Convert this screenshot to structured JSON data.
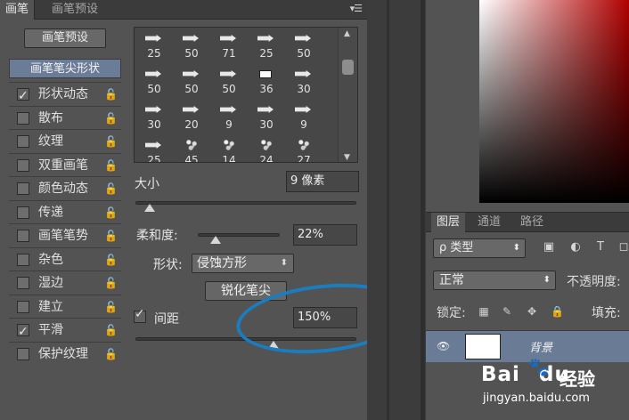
{
  "brush_panel": {
    "tabs": [
      {
        "label": "画笔"
      },
      {
        "label": "画笔预设"
      }
    ],
    "menu_glyph": "▾☰",
    "preset_button": "画笔预设",
    "options_header": "画笔笔尖形状",
    "options": [
      {
        "label": "形状动态",
        "checked": true
      },
      {
        "label": "散布",
        "checked": false
      },
      {
        "label": "纹理",
        "checked": false
      },
      {
        "label": "双重画笔",
        "checked": false
      },
      {
        "label": "颜色动态",
        "checked": false
      },
      {
        "label": "传递",
        "checked": false
      },
      {
        "label": "画笔笔势",
        "checked": false
      },
      {
        "label": "杂色",
        "checked": false
      },
      {
        "label": "湿边",
        "checked": false
      },
      {
        "label": "建立",
        "checked": false
      },
      {
        "label": "平滑",
        "checked": true
      },
      {
        "label": "保护纹理",
        "checked": false
      }
    ],
    "lock_glyph": "🔓",
    "tips": [
      {
        "size": "25",
        "shape": "arrow"
      },
      {
        "size": "50",
        "shape": "arrow"
      },
      {
        "size": "71",
        "shape": "arrow"
      },
      {
        "size": "25",
        "shape": "arrow"
      },
      {
        "size": "50",
        "shape": "arrow"
      },
      {
        "size": "50",
        "shape": "arrow"
      },
      {
        "size": "50",
        "shape": "arrow"
      },
      {
        "size": "50",
        "shape": "arrow"
      },
      {
        "size": "36",
        "shape": "square"
      },
      {
        "size": "30",
        "shape": "arrow"
      },
      {
        "size": "30",
        "shape": "arrow"
      },
      {
        "size": "20",
        "shape": "arrow"
      },
      {
        "size": "9",
        "shape": "arrow"
      },
      {
        "size": "30",
        "shape": "arrow"
      },
      {
        "size": "9",
        "shape": "arrow"
      },
      {
        "size": "25",
        "shape": "arrow"
      },
      {
        "size": "45",
        "shape": "splatter"
      },
      {
        "size": "14",
        "shape": "splatter"
      },
      {
        "size": "24",
        "shape": "splatter"
      },
      {
        "size": "27",
        "shape": "splatter"
      }
    ],
    "size_label": "大小",
    "size_value": "9 像素",
    "hardness_label": "柔和度:",
    "hardness_value": "22%",
    "hardness_fraction": 0.22,
    "shape_label": "形状:",
    "shape_value": "侵蚀方形",
    "sharpen_button": "锐化笔尖",
    "spacing_label": "间距",
    "spacing_value": "150%"
  },
  "layers_panel": {
    "tabs": [
      {
        "label": "图层"
      },
      {
        "label": "通道"
      },
      {
        "label": "路径"
      }
    ],
    "filter_label": "ρ 类型",
    "blend_mode": "正常",
    "opacity_label": "不透明度:",
    "lock_label": "锁定:",
    "fill_label": "填充:",
    "layer_name": "背景"
  },
  "watermark": {
    "brand": "Bai",
    "brand_suffix": "du",
    "paw": "🐾",
    "jingyan": "经验",
    "url": "jingyan.baidu.com"
  },
  "colors": {
    "accent": "#6a7b95",
    "annotation": "#1a7dbf"
  }
}
